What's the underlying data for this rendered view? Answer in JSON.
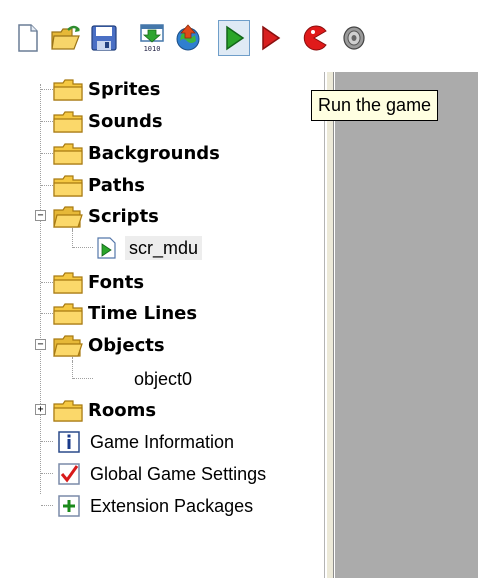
{
  "toolbar": {
    "buttons": [
      {
        "name": "new-icon",
        "label": "New"
      },
      {
        "name": "open-icon",
        "label": "Open"
      },
      {
        "name": "save-icon",
        "label": "Save"
      },
      {
        "name": "create-executable-icon",
        "label": "Create executable"
      },
      {
        "name": "publish-icon",
        "label": "Publish"
      },
      {
        "name": "run-icon",
        "label": "Run the game"
      },
      {
        "name": "debug-run-icon",
        "label": "Debug"
      },
      {
        "name": "create-sprite-icon",
        "label": "Create sprite"
      },
      {
        "name": "create-sound-icon",
        "label": "Create sound"
      }
    ],
    "tooltip": "Run the game"
  },
  "tree": {
    "items": [
      {
        "label": "Sprites",
        "kind": "folder"
      },
      {
        "label": "Sounds",
        "kind": "folder"
      },
      {
        "label": "Backgrounds",
        "kind": "folder"
      },
      {
        "label": "Paths",
        "kind": "folder"
      },
      {
        "label": "Scripts",
        "kind": "folder",
        "expanded": true
      },
      {
        "label": "scr_mdu",
        "kind": "script"
      },
      {
        "label": "Fonts",
        "kind": "folder"
      },
      {
        "label": "Time Lines",
        "kind": "folder"
      },
      {
        "label": "Objects",
        "kind": "folder",
        "expanded": true
      },
      {
        "label": "object0",
        "kind": "object"
      },
      {
        "label": "Rooms",
        "kind": "folder",
        "collapsed": true
      },
      {
        "label": "Game Information",
        "kind": "info"
      },
      {
        "label": "Global Game Settings",
        "kind": "settings"
      },
      {
        "label": "Extension Packages",
        "kind": "extensions"
      }
    ]
  },
  "colors": {
    "folder": "#f5c842",
    "run_green": "#2aa52a",
    "debug_red": "#d82020",
    "tooltip_bg": "#ffffe1",
    "right_pane": "#ababab"
  }
}
